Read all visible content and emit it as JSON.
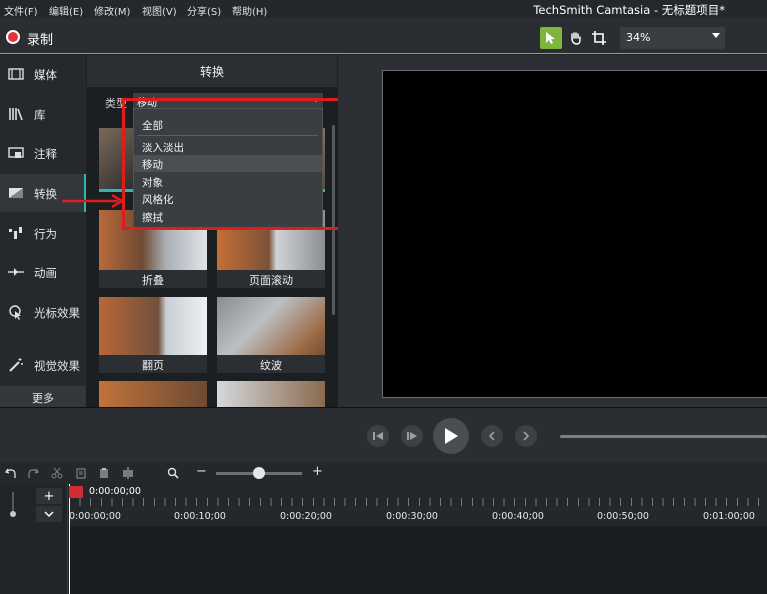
{
  "menubar": {
    "items": [
      "文件(F)",
      "编辑(E)",
      "修改(M)",
      "视图(V)",
      "分享(S)",
      "帮助(H)"
    ],
    "app_title": "TechSmith Camtasia - 无标题项目*"
  },
  "toolbar": {
    "record_label": "录制",
    "zoom_value": "34%"
  },
  "sidebar": {
    "items": [
      {
        "label": "媒体",
        "icon": "film-icon"
      },
      {
        "label": "库",
        "icon": "library-icon"
      },
      {
        "label": "注释",
        "icon": "annotation-icon"
      },
      {
        "label": "转换",
        "icon": "transition-icon"
      },
      {
        "label": "行为",
        "icon": "behavior-icon"
      },
      {
        "label": "动画",
        "icon": "animation-icon"
      },
      {
        "label": "光标效果",
        "icon": "cursor-effect-icon"
      },
      {
        "label": "视觉效果",
        "icon": "magic-wand-icon"
      }
    ],
    "active": "转换",
    "more_label": "更多"
  },
  "transitions": {
    "title": "转换",
    "type_label": "类型",
    "type_value": "移动",
    "dropdown": {
      "items": [
        "全部",
        "淡入淡出",
        "移动",
        "对象",
        "风格化",
        "擦拭"
      ],
      "highlighted": "移动"
    },
    "thumbs": [
      "折叠",
      "页面滚动",
      "翻页",
      "纹波"
    ]
  },
  "timeline": {
    "playhead_time": "0:00:00;00",
    "ruler_labels": [
      "0:00:00;00",
      "0:00:10;00",
      "0:00:20;00",
      "0:00:30;00",
      "0:00:40;00",
      "0:00:50;00",
      "0:01:00;00"
    ]
  },
  "colors": {
    "accent_green": "#7db63a",
    "teal": "#2fb6b4",
    "highlight_red": "#e01c1c",
    "record_red": "#e8333a"
  }
}
